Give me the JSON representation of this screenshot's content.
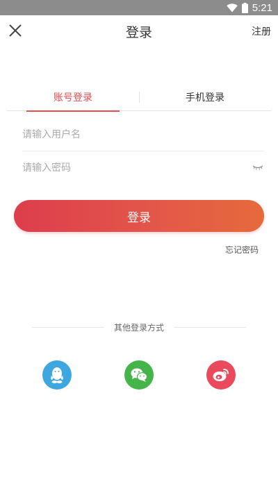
{
  "status_bar": {
    "time": "5:21",
    "wifi_icon": "wifi-icon",
    "battery_icon": "battery-icon"
  },
  "header": {
    "title": "登录",
    "register": "注册",
    "close_icon": "close-icon"
  },
  "tabs": [
    {
      "label": "账号登录",
      "active": true
    },
    {
      "label": "手机登录",
      "active": false
    }
  ],
  "form": {
    "username_placeholder": "请输入用户名",
    "username_value": "",
    "password_placeholder": "请输入密码",
    "password_value": "",
    "eye_icon": "eye-closed-icon"
  },
  "login_button": "登录",
  "forgot_password": "忘记密码",
  "other_login": {
    "title": "其他登录方式",
    "providers": [
      {
        "icon": "qq-icon",
        "color": "#3fa7e0"
      },
      {
        "icon": "wechat-icon",
        "color": "#46b549"
      },
      {
        "icon": "weibo-icon",
        "color": "#e94b5d"
      }
    ]
  },
  "colors": {
    "accent": "#e24f4f",
    "status_bar": "#8c8c8c"
  }
}
